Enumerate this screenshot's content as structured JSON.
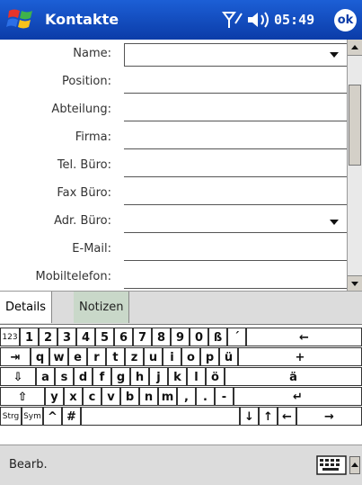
{
  "titlebar": {
    "app_title": "Kontakte",
    "clock": "05:49",
    "ok_label": "ok"
  },
  "form": {
    "fields": [
      {
        "label": "Name:",
        "value": ""
      },
      {
        "label": "Position:",
        "value": ""
      },
      {
        "label": "Abteilung:",
        "value": ""
      },
      {
        "label": "Firma:",
        "value": ""
      },
      {
        "label": "Tel. Büro:",
        "value": ""
      },
      {
        "label": "Fax Büro:",
        "value": ""
      },
      {
        "label": "Adr. Büro:",
        "value": ""
      },
      {
        "label": "E-Mail:",
        "value": ""
      },
      {
        "label": "Mobiltelefon:",
        "value": ""
      }
    ]
  },
  "tabs": {
    "details": "Details",
    "notizen": "Notizen"
  },
  "keyboard": {
    "row1": [
      "123",
      "1",
      "2",
      "3",
      "4",
      "5",
      "6",
      "7",
      "8",
      "9",
      "0",
      "ß",
      "´",
      "←"
    ],
    "row2": [
      "⇥",
      "q",
      "w",
      "e",
      "r",
      "t",
      "z",
      "u",
      "i",
      "o",
      "p",
      "ü",
      "+"
    ],
    "row3": [
      "⇩",
      "a",
      "s",
      "d",
      "f",
      "g",
      "h",
      "j",
      "k",
      "l",
      "ö",
      "ä"
    ],
    "row4": [
      "⇧",
      "y",
      "x",
      "c",
      "v",
      "b",
      "n",
      "m",
      ",",
      ".",
      "-",
      "↵"
    ],
    "row5": [
      "Strg",
      "Sym",
      "^",
      "#",
      " ",
      "↓",
      "↑",
      "←",
      "→"
    ]
  },
  "menubar": {
    "edit_label": "Bearb."
  },
  "colors": {
    "titlebar": "#0b3ca8",
    "menubar": "#dcdcdc"
  }
}
